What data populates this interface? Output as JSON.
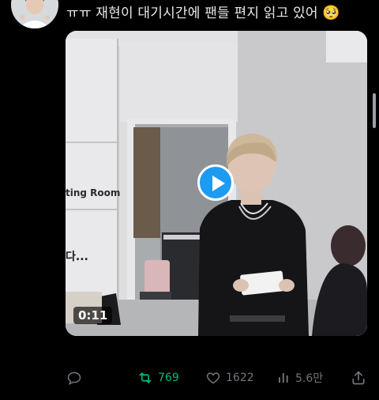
{
  "tweet": {
    "text": "ㅠㅠ 재현이 대기시간에 팬들 편지 읽고 있어",
    "emoji": "🥺"
  },
  "video": {
    "sign_text": "ting Room",
    "duration": "0:11",
    "play_icon": "play-icon"
  },
  "actions": {
    "reply_icon": "reply-icon",
    "retweet_count": "769",
    "like_count": "1622",
    "views_count": "5.6만",
    "share_icon": "share-icon"
  },
  "colors": {
    "background": "#000000",
    "text": "#e7e9ea",
    "muted": "#71767b",
    "retweet_active": "#00ba7c",
    "play_button": "#1d9bf0"
  }
}
